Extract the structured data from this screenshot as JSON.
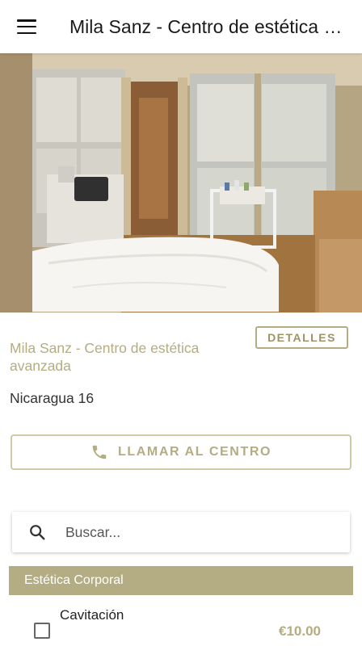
{
  "app_bar": {
    "title": "Mila Sanz - Centro de estética avanzada",
    "menu_icon": "hamburger-menu-icon"
  },
  "hero": {
    "description": "Treatment room photo"
  },
  "center": {
    "name": "Mila Sanz - Centro de estética avanzada",
    "details_label": "DETALLES",
    "address": "Nicaragua 16",
    "call_label": "LLAMAR AL CENTRO",
    "call_icon": "phone-icon"
  },
  "search": {
    "placeholder": "Buscar..."
  },
  "categories": [
    {
      "label": "Estética Corporal",
      "services": [
        {
          "name": "Cavitación",
          "price": "€10.00",
          "checked": false
        }
      ]
    }
  ],
  "colors": {
    "accent": "#b4ac82",
    "accent_border": "#cfc9a8"
  }
}
